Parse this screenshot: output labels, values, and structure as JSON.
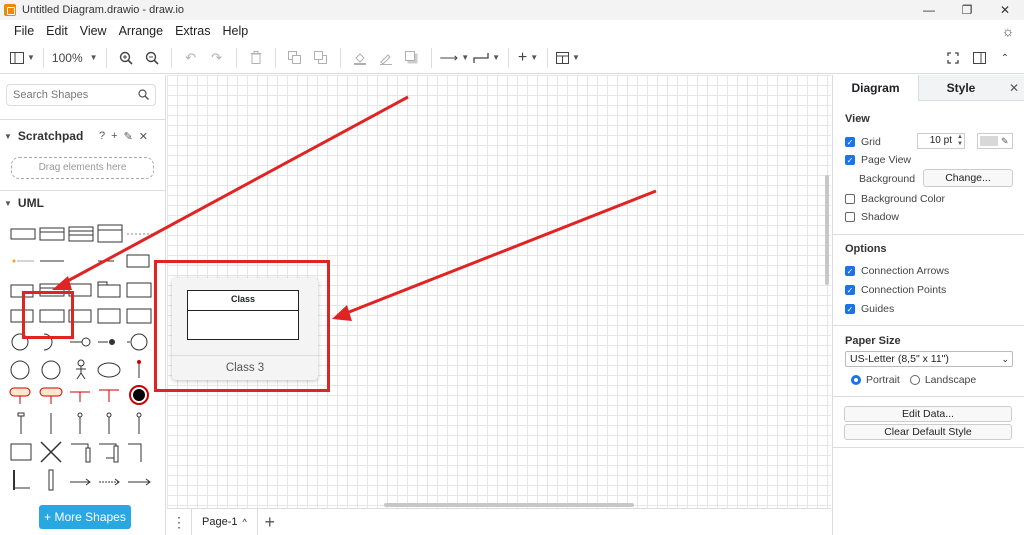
{
  "window": {
    "title": "Untitled Diagram.drawio - draw.io",
    "minimize": "—",
    "maximize": "❐",
    "close": "✕"
  },
  "menu": {
    "items": [
      "File",
      "Edit",
      "View",
      "Arrange",
      "Extras",
      "Help"
    ]
  },
  "toolbar": {
    "zoom": "100%"
  },
  "sidebar": {
    "search_placeholder": "Search Shapes",
    "scratchpad_title": "Scratchpad",
    "drag_hint": "Drag elements here",
    "uml_title": "UML",
    "more_shapes_label": "+ More Shapes"
  },
  "canvas": {
    "hover_card": {
      "shape_title": "Class",
      "label": "Class 3"
    }
  },
  "pages": {
    "tab_label": "Page-1",
    "tab_caret": "^",
    "add": "+"
  },
  "format_panel": {
    "tabs": [
      "Diagram",
      "Style"
    ],
    "view_title": "View",
    "grid_label": "Grid",
    "grid_size": "10 pt",
    "page_view_label": "Page View",
    "background_label": "Background",
    "change_button": "Change...",
    "background_color_label": "Background Color",
    "shadow_label": "Shadow",
    "options_title": "Options",
    "connection_arrows_label": "Connection Arrows",
    "connection_points_label": "Connection Points",
    "guides_label": "Guides",
    "paper_size_title": "Paper Size",
    "paper_size_value": "US-Letter (8,5\" x 11\")",
    "portrait_label": "Portrait",
    "landscape_label": "Landscape",
    "edit_data_button": "Edit Data...",
    "clear_style_button": "Clear Default Style",
    "checks": {
      "grid": true,
      "page_view": true,
      "background_color": false,
      "shadow": false,
      "connection_arrows": true,
      "connection_points": true,
      "guides": true
    },
    "orientation": "portrait"
  },
  "colors": {
    "accent": "#1a73e8",
    "annotation": "#e02424",
    "more_shapes": "#29a7e0",
    "logo": "#f08705"
  }
}
